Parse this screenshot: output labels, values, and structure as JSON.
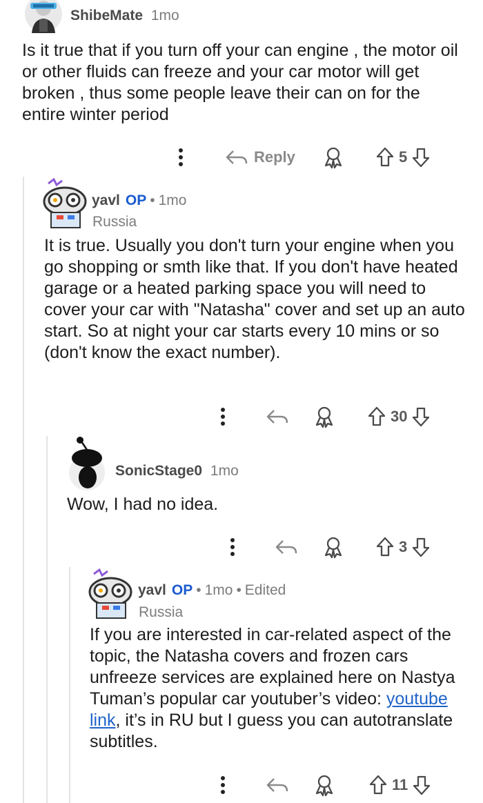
{
  "colors": {
    "op_tag": "#1a5bd0",
    "link": "#1f63c9",
    "meta": "#7c7c7c",
    "thread_line": "#e3e3e3"
  },
  "comments": [
    {
      "user": "ShibeMate",
      "age": "1mo",
      "body": "Is it true that if you turn off your can engine , the motor oil or other fluids can freeze and your car motor will get broken , thus some people leave their can on for the entire winter period",
      "reply_label": "Reply",
      "score": "5"
    },
    {
      "user": "yavl",
      "op_tag": "OP",
      "age": "1mo",
      "flair": "Russia",
      "body": "It is true. Usually you don't turn your engine when you go shopping or smth like that. If you don't have heated garage or a heated parking space you will need to cover your car with \"Natasha\" cover and set up an auto start. So at night your car starts every 10 mins or so (don't know the exact number).",
      "score": "30"
    },
    {
      "user": "SonicStage0",
      "age": "1mo",
      "body": "Wow, I had no idea.",
      "score": "3"
    },
    {
      "user": "yavl",
      "op_tag": "OP",
      "age": "1mo",
      "edited": "Edited",
      "flair": "Russia",
      "body_before": "If you are interested in car-related aspect of the topic, the Natasha covers and frozen cars unfreeze services are explained here on Nastya Tuman’s popular car youtuber’s video: ",
      "link": "youtube link",
      "body_after": ", it’s in RU but I guess you can autotranslate subtitles.",
      "score": "11"
    }
  ]
}
